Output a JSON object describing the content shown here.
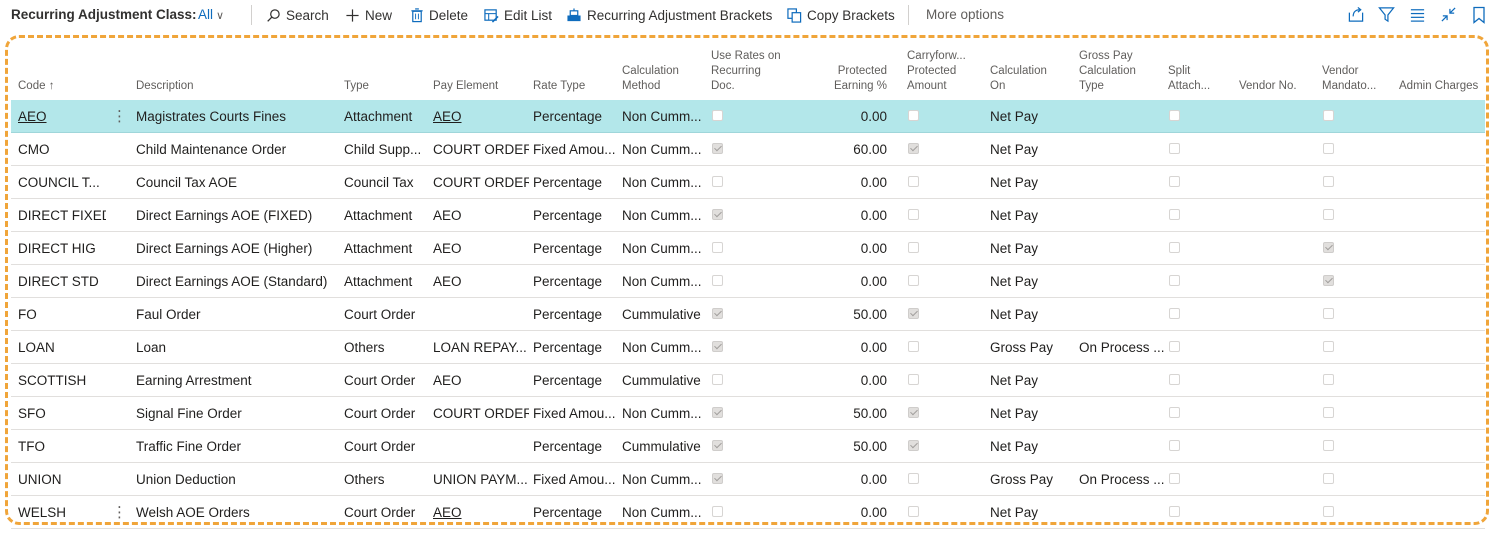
{
  "toolbar": {
    "title": "Recurring Adjustment Class:",
    "view": "All",
    "search": "Search",
    "new": "New",
    "delete": "Delete",
    "edit_list": "Edit List",
    "brackets": "Recurring Adjustment Brackets",
    "copy_brackets": "Copy Brackets",
    "more": "More options"
  },
  "headers": {
    "code": "Code",
    "description": "Description",
    "type": "Type",
    "pay_element": "Pay Element",
    "rate_type": "Rate Type",
    "calc_method_1": "Calculation",
    "calc_method_2": "Method",
    "use_rates_1": "Use Rates on",
    "use_rates_2": "Recurring",
    "use_rates_3": "Doc.",
    "protected_1": "Protected",
    "protected_2": "Earning %",
    "carry_1": "Carryforw...",
    "carry_2": "Protected",
    "carry_3": "Amount",
    "calc_on_1": "Calculation",
    "calc_on_2": "On",
    "gross_1": "Gross Pay",
    "gross_2": "Calculation",
    "gross_3": "Type",
    "split_1": "Split",
    "split_2": "Attach...",
    "vendor_no": "Vendor No.",
    "vendor_m_1": "Vendor",
    "vendor_m_2": "Mandato...",
    "admin": "Admin Charges"
  },
  "rows": [
    {
      "code": "AEO",
      "desc": "Magistrates Courts Fines",
      "type": "Attachment",
      "pay": "AEO",
      "rate": "Percentage",
      "method": "Non Cumm...",
      "use_rates": false,
      "prot": "0.00",
      "carry": false,
      "calc_on": "Net Pay",
      "gross": "",
      "split": false,
      "vendor_no": "",
      "mandatory": false,
      "admin": ""
    },
    {
      "code": "CMO",
      "desc": "Child Maintenance Order",
      "type": "Child Supp...",
      "pay": "COURT ORDER",
      "rate": "Fixed Amou...",
      "method": "Non Cumm...",
      "use_rates": true,
      "prot": "60.00",
      "carry": true,
      "calc_on": "Net Pay",
      "gross": "",
      "split": false,
      "vendor_no": "",
      "mandatory": false,
      "admin": ""
    },
    {
      "code": "COUNCIL T...",
      "desc": "Council Tax AOE",
      "type": "Council Tax",
      "pay": "COURT ORDER",
      "rate": "Percentage",
      "method": "Non Cumm...",
      "use_rates": false,
      "prot": "0.00",
      "carry": false,
      "calc_on": "Net Pay",
      "gross": "",
      "split": false,
      "vendor_no": "",
      "mandatory": false,
      "admin": ""
    },
    {
      "code": "DIRECT FIXED",
      "desc": "Direct Earnings AOE (FIXED)",
      "type": "Attachment",
      "pay": "AEO",
      "rate": "Percentage",
      "method": "Non Cumm...",
      "use_rates": true,
      "prot": "0.00",
      "carry": false,
      "calc_on": "Net Pay",
      "gross": "",
      "split": false,
      "vendor_no": "",
      "mandatory": false,
      "admin": ""
    },
    {
      "code": "DIRECT HIG",
      "desc": "Direct Earnings AOE (Higher)",
      "type": "Attachment",
      "pay": "AEO",
      "rate": "Percentage",
      "method": "Non Cumm...",
      "use_rates": false,
      "prot": "0.00",
      "carry": false,
      "calc_on": "Net Pay",
      "gross": "",
      "split": false,
      "vendor_no": "",
      "mandatory": true,
      "admin": ""
    },
    {
      "code": "DIRECT STD",
      "desc": "Direct Earnings AOE (Standard)",
      "type": "Attachment",
      "pay": "AEO",
      "rate": "Percentage",
      "method": "Non Cumm...",
      "use_rates": false,
      "prot": "0.00",
      "carry": false,
      "calc_on": "Net Pay",
      "gross": "",
      "split": false,
      "vendor_no": "",
      "mandatory": true,
      "admin": ""
    },
    {
      "code": "FO",
      "desc": "Faul Order",
      "type": "Court Order",
      "pay": "",
      "rate": "Percentage",
      "method": "Cummulative",
      "use_rates": true,
      "prot": "50.00",
      "carry": true,
      "calc_on": "Net Pay",
      "gross": "",
      "split": false,
      "vendor_no": "",
      "mandatory": false,
      "admin": ""
    },
    {
      "code": "LOAN",
      "desc": "Loan",
      "type": "Others",
      "pay": "LOAN REPAY...",
      "rate": "Percentage",
      "method": "Non Cumm...",
      "use_rates": true,
      "prot": "0.00",
      "carry": false,
      "calc_on": "Gross Pay",
      "gross": "On Process ...",
      "split": false,
      "vendor_no": "",
      "mandatory": false,
      "admin": ""
    },
    {
      "code": "SCOTTISH",
      "desc": "Earning Arrestment",
      "type": "Court Order",
      "pay": "AEO",
      "rate": "Percentage",
      "method": "Cummulative",
      "use_rates": false,
      "prot": "0.00",
      "carry": false,
      "calc_on": "Net Pay",
      "gross": "",
      "split": false,
      "vendor_no": "",
      "mandatory": false,
      "admin": ""
    },
    {
      "code": "SFO",
      "desc": "Signal Fine Order",
      "type": "Court Order",
      "pay": "COURT ORDER",
      "rate": "Fixed Amou...",
      "method": "Non Cumm...",
      "use_rates": true,
      "prot": "50.00",
      "carry": true,
      "calc_on": "Net Pay",
      "gross": "",
      "split": false,
      "vendor_no": "",
      "mandatory": false,
      "admin": ""
    },
    {
      "code": "TFO",
      "desc": "Traffic Fine Order",
      "type": "Court Order",
      "pay": "",
      "rate": "Percentage",
      "method": "Cummulative",
      "use_rates": true,
      "prot": "50.00",
      "carry": true,
      "calc_on": "Net Pay",
      "gross": "",
      "split": false,
      "vendor_no": "",
      "mandatory": false,
      "admin": ""
    },
    {
      "code": "UNION",
      "desc": "Union Deduction",
      "type": "Others",
      "pay": "UNION PAYM...",
      "rate": "Fixed Amou...",
      "method": "Non Cumm...",
      "use_rates": true,
      "prot": "0.00",
      "carry": false,
      "calc_on": "Gross Pay",
      "gross": "On Process ...",
      "split": false,
      "vendor_no": "",
      "mandatory": false,
      "admin": ""
    },
    {
      "code": "WELSH",
      "desc": "Welsh AOE Orders",
      "type": "Court Order",
      "pay": "AEO",
      "rate": "Percentage",
      "method": "Non Cumm...",
      "use_rates": false,
      "prot": "0.00",
      "carry": false,
      "calc_on": "Net Pay",
      "gross": "",
      "split": false,
      "vendor_no": "",
      "mandatory": false,
      "admin": ""
    }
  ]
}
